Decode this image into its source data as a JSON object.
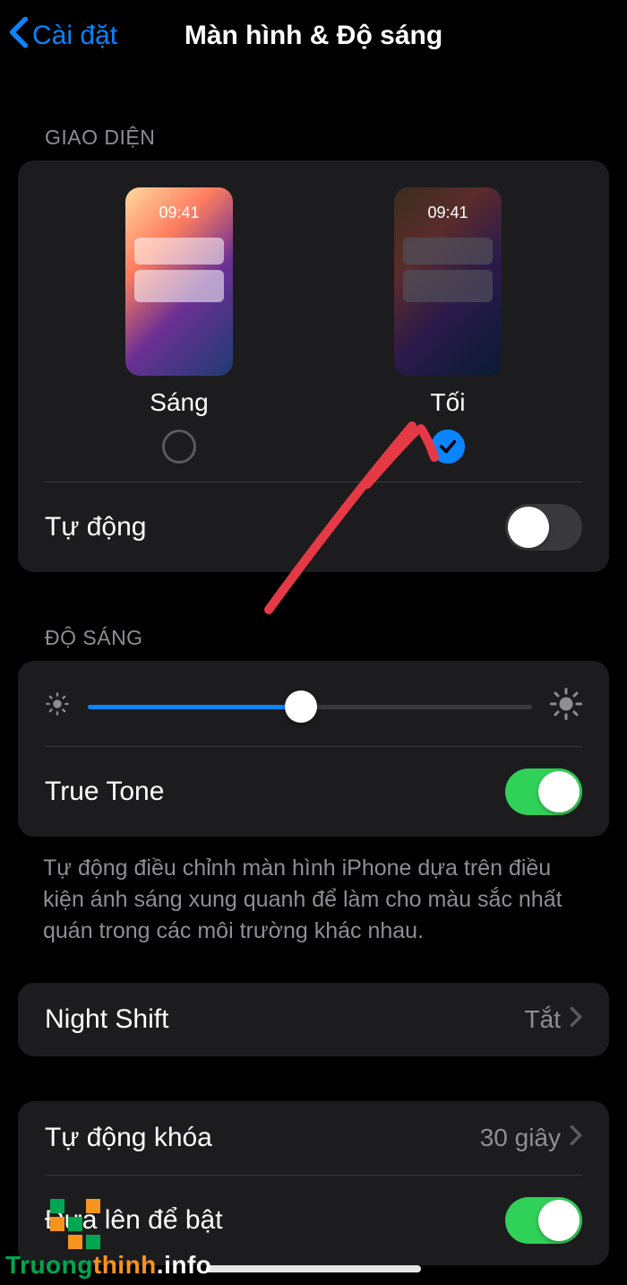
{
  "header": {
    "back_label": "Cài đặt",
    "title": "Màn hình & Độ sáng"
  },
  "appearance": {
    "section_label": "GIAO DIỆN",
    "preview_time": "09:41",
    "options": [
      {
        "label": "Sáng",
        "selected": false
      },
      {
        "label": "Tối",
        "selected": true
      }
    ],
    "auto_label": "Tự động",
    "auto_on": false
  },
  "brightness": {
    "section_label": "ĐỘ SÁNG",
    "value_percent": 48,
    "true_tone_label": "True Tone",
    "true_tone_on": true,
    "footer": "Tự động điều chỉnh màn hình iPhone dựa trên điều kiện ánh sáng xung quanh để làm cho màu sắc nhất quán trong các môi trường khác nhau."
  },
  "night_shift": {
    "label": "Night Shift",
    "value": "Tắt"
  },
  "auto_lock": {
    "label": "Tự động khóa",
    "value": "30 giây"
  },
  "raise_to_wake": {
    "label": "Đưa lên để bật",
    "on": true
  },
  "watermark": {
    "part1": "Truong",
    "part2": "thinh",
    "part3": ".info"
  }
}
